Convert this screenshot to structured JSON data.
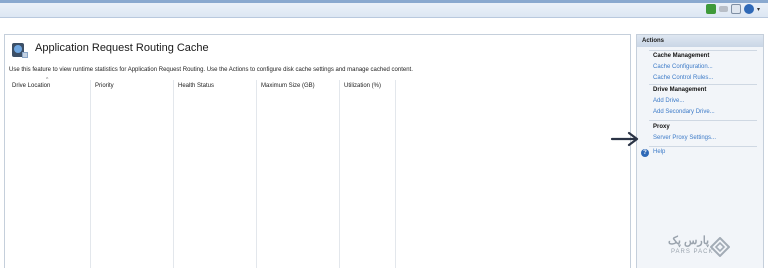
{
  "toolbar": {
    "icons": [
      "connect-icon",
      "minimize-icon",
      "document-icon",
      "help-icon"
    ]
  },
  "main": {
    "title": "Application Request Routing Cache",
    "description": "Use this feature to view runtime statistics for Application Request Routing.  Use the Actions to configure disk cache settings and manage cached content.",
    "columns": [
      "Drive Location",
      "Priority",
      "Health Status",
      "Maximum Size (GB)",
      "Utilization (%)"
    ]
  },
  "actions": {
    "title": "Actions",
    "cache_management": {
      "heading": "Cache Management",
      "links": [
        "Cache Configuration...",
        "Cache Control Rules..."
      ]
    },
    "drive_management": {
      "heading": "Drive Management",
      "links": [
        "Add Drive...",
        "Add Secondary Drive..."
      ]
    },
    "proxy": {
      "heading": "Proxy",
      "links": [
        "Server Proxy Settings..."
      ]
    },
    "help": "Help"
  },
  "watermark": {
    "fa": "پارس پک",
    "en": "PARS PACK"
  },
  "colors": {
    "link": "#3d7bc8",
    "header_bg": "#c9d6e6",
    "arrow": "#2b3446"
  }
}
